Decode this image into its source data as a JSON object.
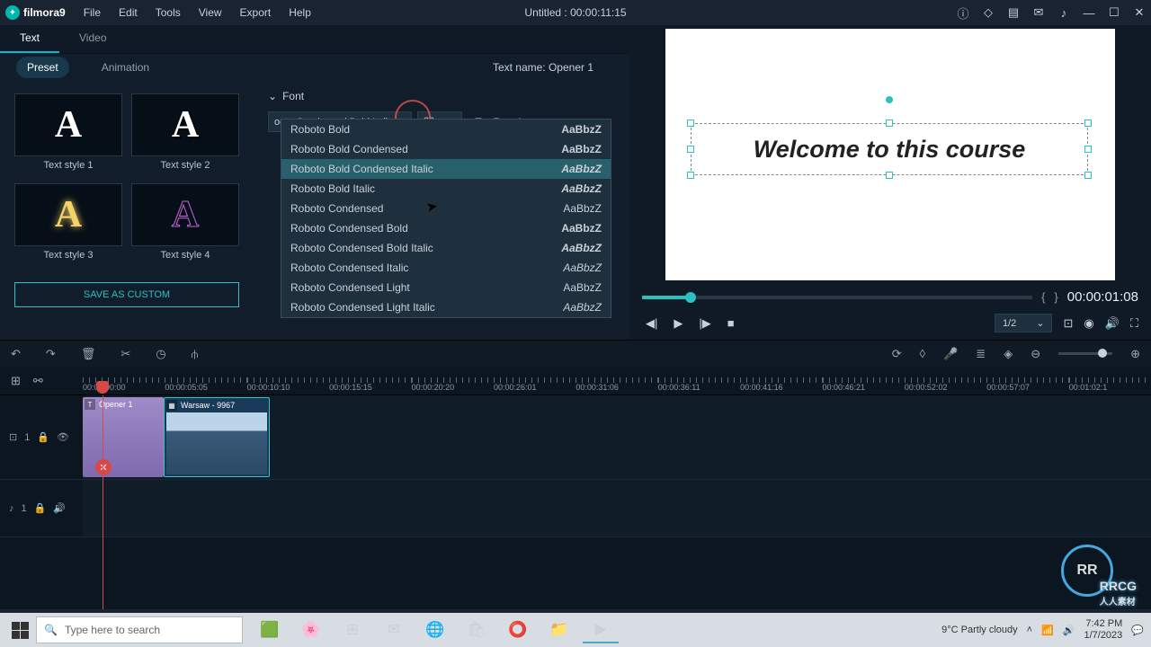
{
  "titlebar": {
    "app_name": "filmora9",
    "menus": [
      "File",
      "Edit",
      "Tools",
      "View",
      "Export",
      "Help"
    ],
    "title": "Untitled : 00:00:11:15"
  },
  "top_tabs": {
    "text": "Text",
    "video": "Video"
  },
  "sub_tabs": {
    "preset": "Preset",
    "animation": "Animation"
  },
  "text_name": "Text name: Opener 1",
  "styles": [
    {
      "label": "Text style 1",
      "fg": "#ffffff",
      "style": "normal"
    },
    {
      "label": "Text style 2",
      "fg": "#ffffff",
      "style": "shadow"
    },
    {
      "label": "Text style 3",
      "fg": "#f4d269",
      "style": "glow"
    },
    {
      "label": "Text style 4",
      "fg": "#c766d8",
      "style": "outline"
    }
  ],
  "save_custom": "SAVE AS CUSTOM",
  "font_section_title": "Font",
  "font_selected": "ooto Condensed Bold Italic",
  "font_size": "80",
  "font_options": [
    {
      "name": "Roboto Bold",
      "sample": "AaBbzZ",
      "weight": "bold",
      "italic": false
    },
    {
      "name": "Roboto Bold Condensed",
      "sample": "AaBbzZ",
      "weight": "bold",
      "italic": false
    },
    {
      "name": "Roboto Bold Condensed Italic",
      "sample": "AaBbzZ",
      "weight": "bold",
      "italic": true,
      "highlighted": true
    },
    {
      "name": "Roboto Bold Italic",
      "sample": "AaBbzZ",
      "weight": "bold",
      "italic": true
    },
    {
      "name": "Roboto Condensed",
      "sample": "AaBbzZ",
      "weight": "normal",
      "italic": false
    },
    {
      "name": "Roboto Condensed Bold",
      "sample": "AaBbzZ",
      "weight": "bold",
      "italic": false
    },
    {
      "name": "Roboto Condensed Bold Italic",
      "sample": "AaBbzZ",
      "weight": "bold",
      "italic": true
    },
    {
      "name": "Roboto Condensed Italic",
      "sample": "AaBbzZ",
      "weight": "normal",
      "italic": true
    },
    {
      "name": "Roboto Condensed Light",
      "sample": "AaBbzZ",
      "weight": "300",
      "italic": false
    },
    {
      "name": "Roboto Condensed Light Italic",
      "sample": "AaBbzZ",
      "weight": "300",
      "italic": true
    }
  ],
  "preview_text": "Welcome to this course",
  "preview_tc": "00:00:01:08",
  "zoom_level": "1/2",
  "timeline": {
    "ruler": [
      "00:00:00:00",
      "00:00:05:05",
      "00:00:10:10",
      "00:00:15:15",
      "00:00:20:20",
      "00:00:26:01",
      "00:00:31:06",
      "00:00:36:11",
      "00:00:41:16",
      "00:00:46:21",
      "00:00:52:02",
      "00:00:57:07",
      "00:01:02:1"
    ],
    "video_track_label": "1",
    "audio_track_label": "1",
    "clip1": "Opener 1",
    "clip2": "Warsaw - 9967"
  },
  "taskbar": {
    "search_placeholder": "Type here to search",
    "weather": "9°C  Partly cloudy",
    "time": "7:42 PM",
    "date": "1/7/2023"
  },
  "watermark": {
    "brand": "RR",
    "text": "RRCG",
    "sub": "人人素材"
  }
}
